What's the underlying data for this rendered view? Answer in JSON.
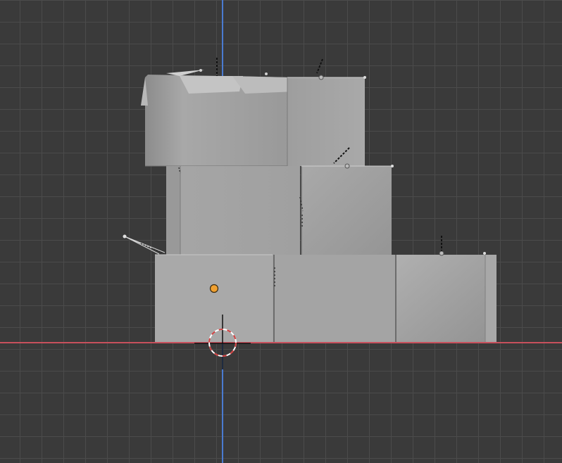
{
  "viewport": {
    "name": "3D Viewport",
    "view": "front-orthographic",
    "background_color": "#3a3a3a",
    "grid_color": "#4b4b4b",
    "axis_x_color": "#c8505c",
    "axis_z_color": "#4a7bd0"
  },
  "scene": {
    "objects": [
      {
        "name": "box-top-left",
        "type": "mesh",
        "material_color": "#9a9a9a"
      },
      {
        "name": "box-top-right",
        "type": "mesh",
        "material_color": "#a0a0a0"
      },
      {
        "name": "box-middle-left",
        "type": "mesh",
        "material_color": "#a5a5a5"
      },
      {
        "name": "box-middle-right",
        "type": "mesh",
        "material_color": "#9c9c9c"
      },
      {
        "name": "box-bottom-left",
        "type": "mesh",
        "material_color": "#a8a8a8"
      },
      {
        "name": "box-bottom-middle",
        "type": "mesh",
        "material_color": "#a3a3a3"
      },
      {
        "name": "box-bottom-right",
        "type": "mesh",
        "material_color": "#9e9e9e"
      },
      {
        "name": "camera",
        "type": "camera"
      },
      {
        "name": "light-1",
        "type": "light"
      },
      {
        "name": "light-2",
        "type": "light"
      },
      {
        "name": "light-3",
        "type": "light"
      },
      {
        "name": "light-4",
        "type": "light"
      }
    ],
    "active_object_origin_color": "#f0a030",
    "cursor_colors": [
      "#d04040",
      "#ffffff"
    ]
  }
}
